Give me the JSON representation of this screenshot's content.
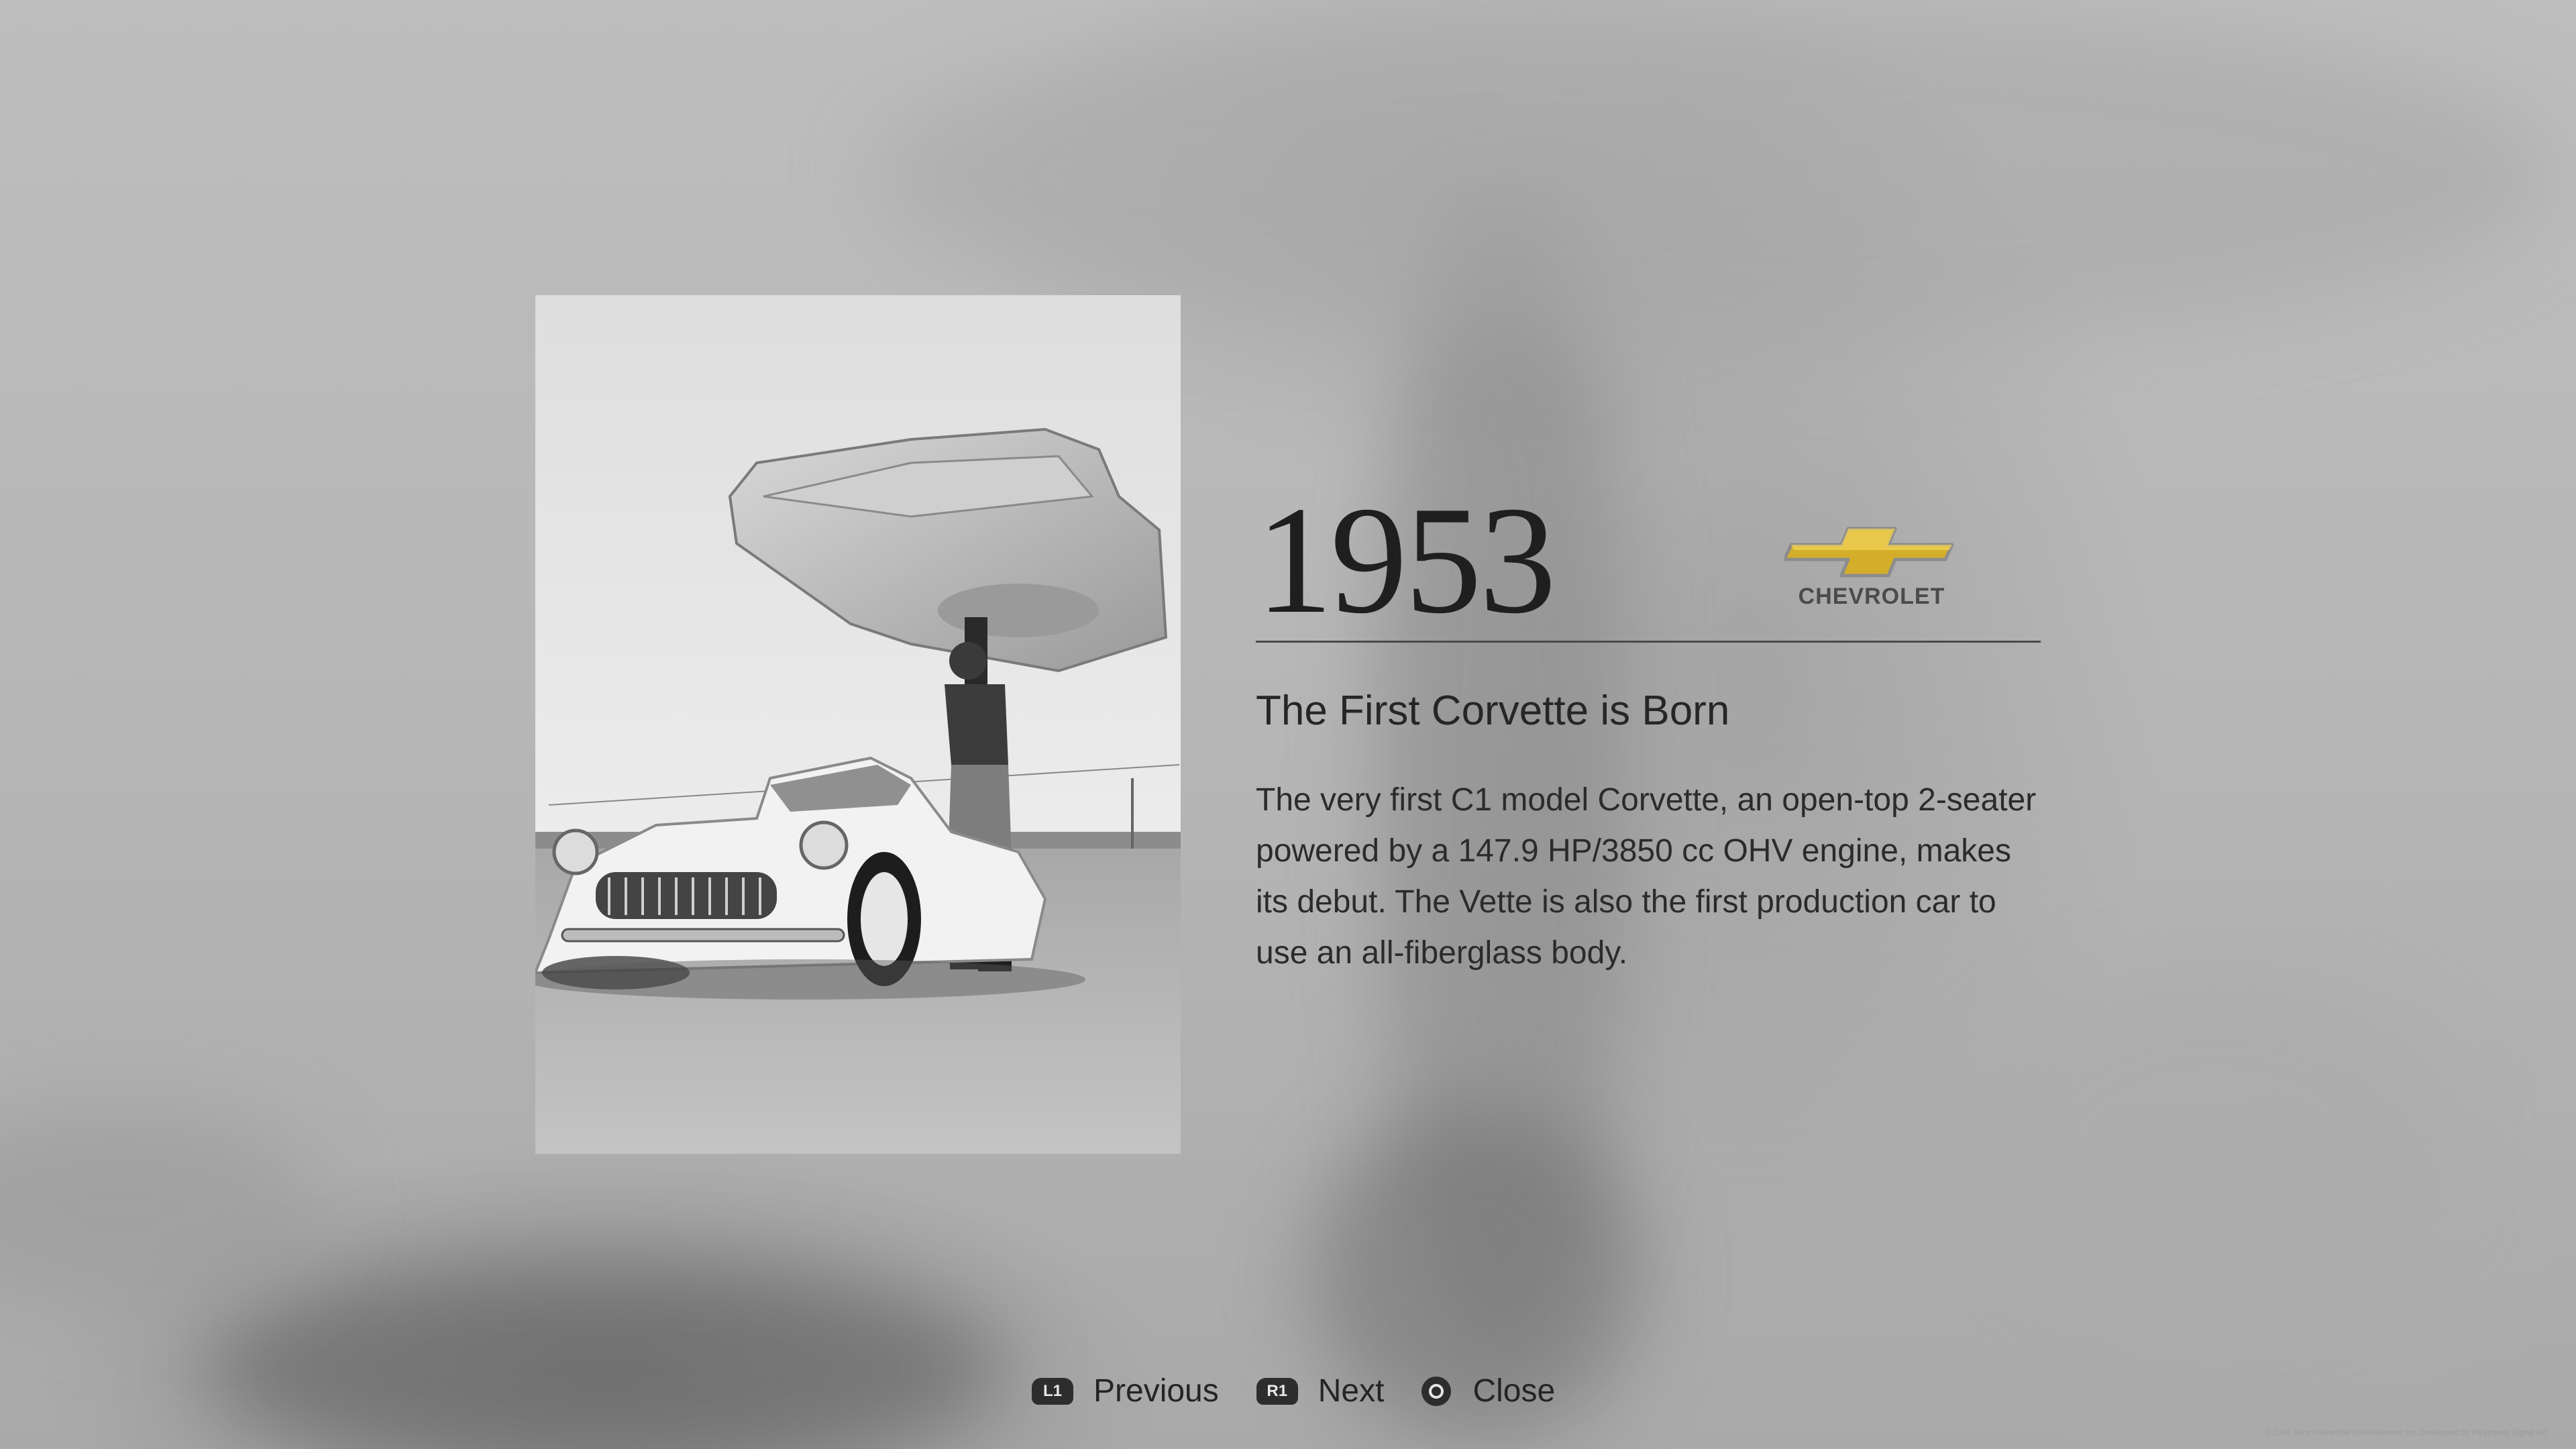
{
  "entry": {
    "year": "1953",
    "brand": "CHEVROLET",
    "title": "The First Corvette is Born",
    "description": "The very first C1 model Corvette, an open-top 2-seater powered by a 147.9 HP/3850 cc OHV engine, makes its debut. The Vette is also the first production car to use an all-fiberglass body."
  },
  "controls": {
    "previous": {
      "button": "L1",
      "label": "Previous"
    },
    "next": {
      "button": "R1",
      "label": "Next"
    },
    "close": {
      "icon": "circle-button-icon",
      "label": "Close"
    }
  },
  "footer": {
    "copyright": "© 2024 Sony Interactive Entertainment Inc. Developed by Polyphony Digital Inc."
  },
  "colors": {
    "text": "#262626",
    "logo_gold": "#d4ae2a",
    "badge": "#2d2d2d"
  }
}
